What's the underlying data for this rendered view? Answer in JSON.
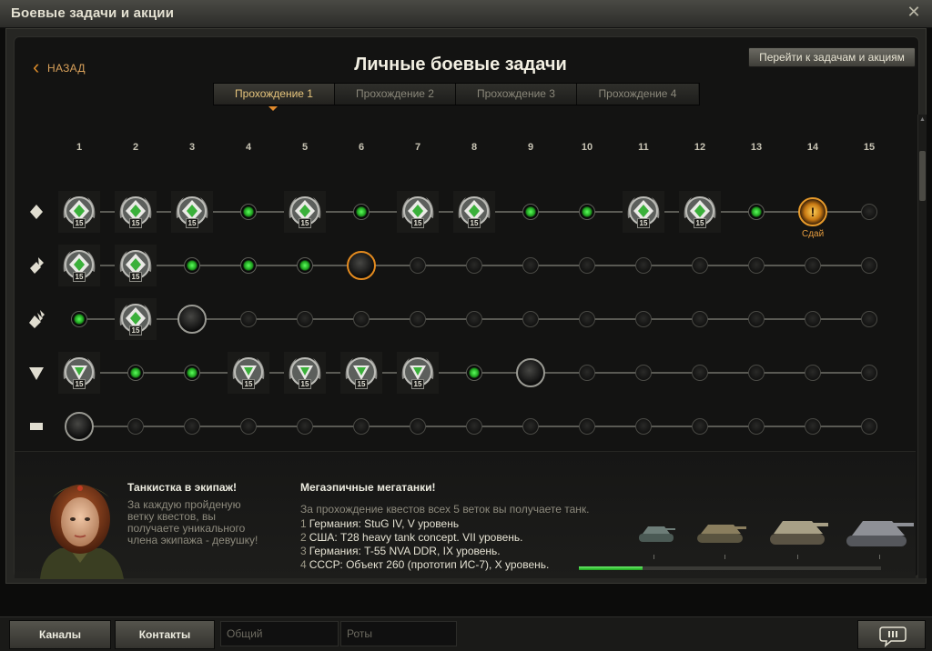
{
  "window": {
    "title": "Боевые задачи и акции"
  },
  "header": {
    "back_label": "НАЗАД",
    "title": "Личные боевые задачи",
    "goto_button": "Перейти к задачам и акциям"
  },
  "tabs": [
    {
      "label": "Прохождение 1",
      "active": true
    },
    {
      "label": "Прохождение 2",
      "active": false
    },
    {
      "label": "Прохождение 3",
      "active": false
    },
    {
      "label": "Прохождение 4",
      "active": false
    }
  ],
  "columns": [
    "1",
    "2",
    "3",
    "4",
    "5",
    "6",
    "7",
    "8",
    "9",
    "10",
    "11",
    "12",
    "13",
    "14",
    "15"
  ],
  "rows": [
    {
      "icon": "light-tank-icon",
      "nodes": [
        "medal",
        "medal",
        "medal",
        "green",
        "medal",
        "green",
        "medal",
        "medal",
        "green",
        "green",
        "medal",
        "medal",
        "green",
        "alert",
        "empty"
      ]
    },
    {
      "icon": "medium-tank-icon",
      "nodes": [
        "medal",
        "medal",
        "green",
        "green",
        "green",
        "current-orange",
        "empty",
        "empty",
        "empty",
        "empty",
        "empty",
        "empty",
        "empty",
        "empty",
        "empty"
      ]
    },
    {
      "icon": "heavy-tank-icon",
      "nodes": [
        "green",
        "medal",
        "current",
        "empty",
        "empty",
        "empty",
        "empty",
        "empty",
        "empty",
        "empty",
        "empty",
        "empty",
        "empty",
        "empty",
        "empty"
      ]
    },
    {
      "icon": "td-icon",
      "nodes": [
        "medal",
        "green",
        "green",
        "medal",
        "medal",
        "medal",
        "medal",
        "green",
        "current",
        "empty",
        "empty",
        "empty",
        "empty",
        "empty",
        "empty"
      ]
    },
    {
      "icon": "spg-icon",
      "nodes": [
        "current",
        "empty",
        "empty",
        "empty",
        "empty",
        "empty",
        "empty",
        "empty",
        "empty",
        "empty",
        "empty",
        "empty",
        "empty",
        "empty",
        "empty"
      ]
    }
  ],
  "medal_level": "15",
  "alert_symbol": "!",
  "alert_caption": "Сдай",
  "crew_reward": {
    "title": "Танкистка в экипаж!",
    "description": "За каждую пройденую ветку квестов, вы получаете уникального члена экипажа - девушку!"
  },
  "mega_reward": {
    "title": "Мегаэпичные мегатанки!",
    "intro": "За прохождение квестов всех 5 веток вы получаете танк.",
    "items": [
      {
        "num": "1",
        "text": "Германия: StuG IV, V уровень"
      },
      {
        "num": "2",
        "text": "США: T28 heavy tank concept. VII уровень."
      },
      {
        "num": "3",
        "text": "Германия: T-55 NVA DDR, IX уровень."
      },
      {
        "num": "4",
        "text": "СССР: Объект 260 (прототип ИС-7), X уровень."
      }
    ],
    "progress": 0.21
  },
  "chat": {
    "channels_label": "Каналы",
    "contacts_label": "Контакты",
    "general_label": "Общий",
    "companies_label": "Роты"
  },
  "colors": {
    "accent_orange": "#e48b1f",
    "complete_green": "#3fd43f",
    "title_text": "#f2efe2"
  }
}
